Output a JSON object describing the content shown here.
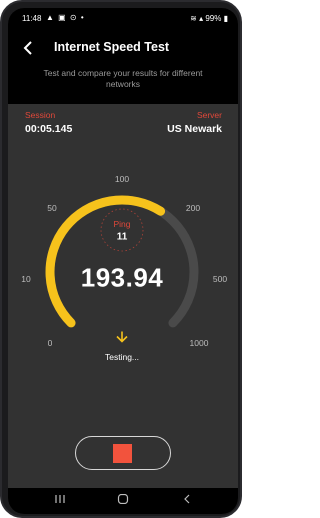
{
  "status_bar": {
    "time": "11:48",
    "left_icons": "▲ ▣ ⊙ •",
    "battery": "99%"
  },
  "app": {
    "title": "Internet Speed Test",
    "subtitle": "Test and compare your results for different networks"
  },
  "session": {
    "label": "Session",
    "value": "00:05.145"
  },
  "server": {
    "label": "Server",
    "value": "US Newark"
  },
  "gauge": {
    "scale_labels": [
      "0",
      "10",
      "50",
      "100",
      "200",
      "500",
      "1000"
    ],
    "progress": 0.62,
    "colors": {
      "active": "#f6c21c",
      "track": "#4a4a4a",
      "accent": "#e0483a"
    }
  },
  "ping": {
    "label": "Ping",
    "value": "11"
  },
  "speed": {
    "value": "193.94"
  },
  "status": {
    "text": "Testing...",
    "icon": "download-arrow-icon"
  },
  "controls": {
    "stop_icon": "stop-icon",
    "stop_color": "#f2533d"
  },
  "nav": {
    "icons": [
      "recents-icon",
      "home-icon",
      "back-icon"
    ]
  }
}
